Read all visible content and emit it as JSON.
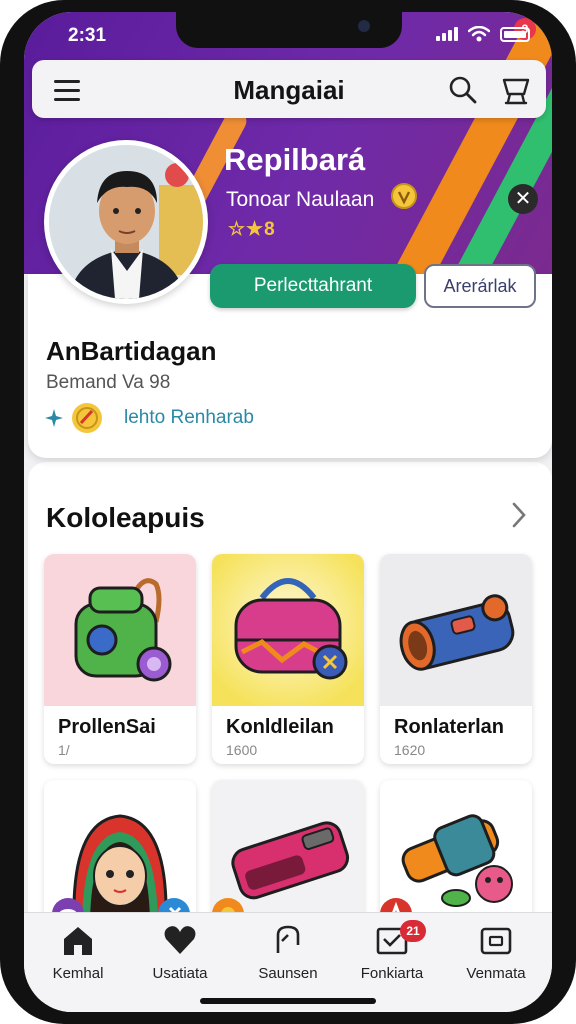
{
  "status_bar": {
    "time": "2:31"
  },
  "app_bar": {
    "title": "Mangaiai",
    "cart_count": "3"
  },
  "profile": {
    "name": "Repilbará",
    "subtitle": "Tonoar Naulaan",
    "rating": "☆★8",
    "primary_button": "Perlecttahrant",
    "secondary_button": "Arerárlak"
  },
  "profile_card": {
    "title": "AnBartidagan",
    "subtitle": "Bemand Va 98",
    "tag_text": "lehto Renharab"
  },
  "collection": {
    "title": "Kololeapuis",
    "items": [
      {
        "name": "ProllenSai",
        "price": "1/"
      },
      {
        "name": "Konldleilan",
        "price": "1600"
      },
      {
        "name": "Ronlaterlan",
        "price": "1620"
      }
    ]
  },
  "bottom_nav": {
    "items": [
      {
        "label": "Kemhal"
      },
      {
        "label": "Usatiata"
      },
      {
        "label": "Saunsen"
      },
      {
        "label": "Fonkiarta"
      },
      {
        "label": "Venmata"
      }
    ],
    "badge": "21"
  },
  "colors": {
    "hero_purple": "#5a1c9c",
    "primary_green": "#1a9a6e",
    "badge_red": "#e8364a",
    "tag_teal": "#2a8aa6"
  }
}
